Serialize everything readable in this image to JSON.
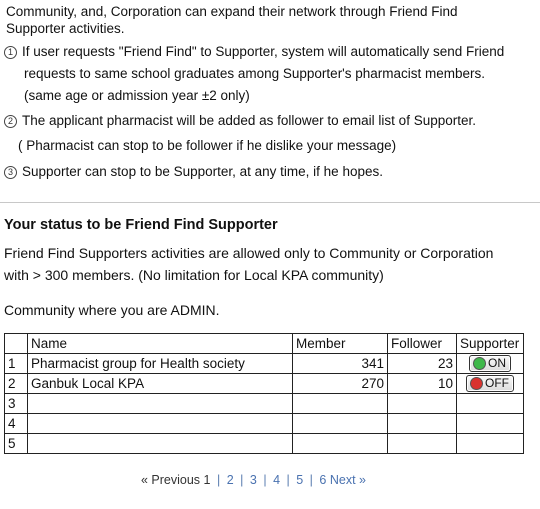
{
  "intro": {
    "line1": "Community, and, Corporation  can expand their network through Friend Find",
    "line2": "Supporter activities."
  },
  "rules": [
    {
      "num": "1",
      "lines": [
        "If user  requests \"Friend Find\" to Supporter, system will automatically send Friend",
        "requests to same school graduates among Supporter's pharmacist members.",
        "(same age or admission year  ±2  only)"
      ]
    },
    {
      "num": "2",
      "lines": [
        "The applicant pharmacist will be added as follower to  email list of Supporter.",
        "( Pharmacist can stop to be follower if he dislike your message)"
      ]
    },
    {
      "num": "3",
      "lines": [
        "Supporter can stop to be Supporter, at any time, if he hopes."
      ]
    }
  ],
  "status": {
    "title": "Your status to be Friend Find Supporter",
    "text1": "Friend Find Supporters activities are allowed only to Community or Corporation",
    "text2": "with > 300 members. (No limitation for Local KPA community)",
    "admin_label": "Community where you are ADMIN."
  },
  "table": {
    "headers": [
      "",
      "Name",
      "Member",
      "Follower",
      "Supporter"
    ],
    "rows": [
      {
        "idx": "1",
        "name": "Pharmacist group for Health society",
        "member": "341",
        "follower": "23",
        "supporter": "ON",
        "color": "#3fb84a"
      },
      {
        "idx": "2",
        "name": "Ganbuk Local KPA",
        "member": "270",
        "follower": "10",
        "supporter": "OFF",
        "color": "#d9322e"
      },
      {
        "idx": "3",
        "name": "",
        "member": "",
        "follower": "",
        "supporter": ""
      },
      {
        "idx": "4",
        "name": "",
        "member": "",
        "follower": "",
        "supporter": ""
      },
      {
        "idx": "5",
        "name": "",
        "member": "",
        "follower": "",
        "supporter": ""
      }
    ]
  },
  "pager": {
    "prev": "« Previous",
    "current": "1",
    "pages": [
      "2",
      "3",
      "4",
      "5",
      "6"
    ],
    "next": "Next »"
  }
}
